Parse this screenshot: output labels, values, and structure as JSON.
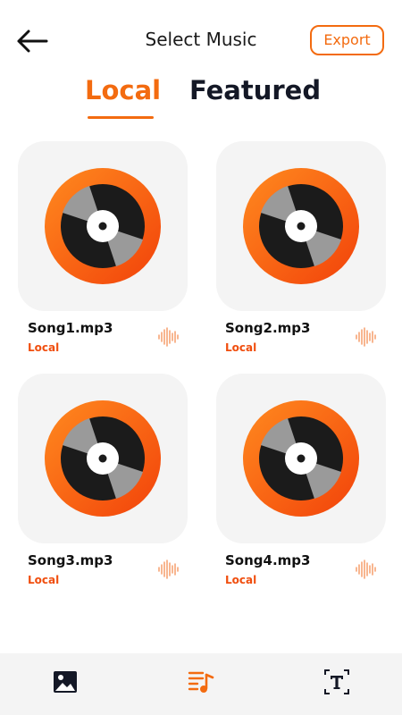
{
  "header": {
    "title": "Select Music",
    "export_label": "Export"
  },
  "tabs": [
    {
      "label": "Local",
      "active": true
    },
    {
      "label": "Featured",
      "active": false
    }
  ],
  "songs": [
    {
      "name": "Song1.mp3",
      "source": "Local"
    },
    {
      "name": "Song2.mp3",
      "source": "Local"
    },
    {
      "name": "Song3.mp3",
      "source": "Local"
    },
    {
      "name": "Song4.mp3",
      "source": "Local"
    }
  ],
  "icons": {
    "back": "arrow-left-icon",
    "disc": "vinyl-disc-icon",
    "wave": "sound-wave-icon",
    "nav_image": "image-icon",
    "nav_music": "music-playlist-icon",
    "nav_text": "text-icon"
  },
  "colors": {
    "accent": "#f36b10",
    "accent_gradient_start": "#ff8a1f",
    "accent_gradient_end": "#f2420a",
    "card_bg": "#f4f4f4",
    "dark": "#141826"
  }
}
